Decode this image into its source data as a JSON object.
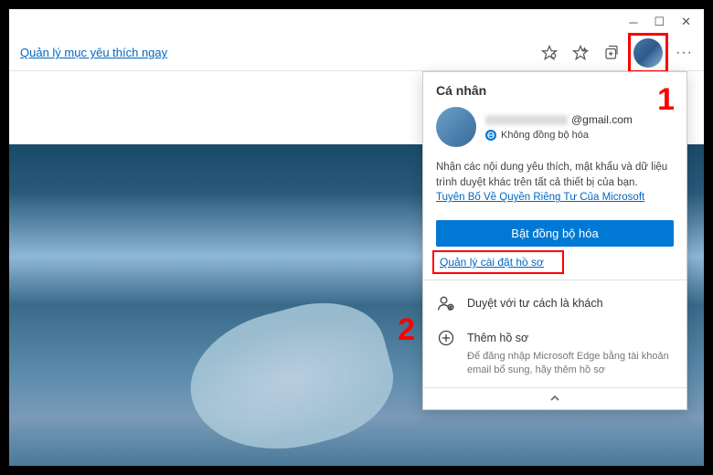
{
  "titlebar": {
    "minimize": "─",
    "maximize": "☐",
    "close": "✕"
  },
  "toolbar": {
    "favorites_link": "Quản lý mục yêu thích ngay"
  },
  "popup": {
    "title": "Cá nhân",
    "email_suffix": "@gmail.com",
    "sync_status": "Không đồng bộ hóa",
    "description": "Nhận các nội dung yêu thích, mật khẩu và dữ liệu trình duyệt khác trên tất cả thiết bị của bạn.",
    "privacy_link": "Tuyên Bố Về Quyền Riêng Tư Của Microsoft",
    "sync_button": "Bật đồng bộ hóa",
    "manage_profile": "Quản lý cài đặt hồ sơ",
    "guest_browse": "Duyệt với tư cách là khách",
    "add_profile": "Thêm hồ sơ",
    "add_profile_desc": "Để đăng nhập Microsoft Edge bằng tài khoản email bổ sung, hãy thêm hồ sơ"
  },
  "annotations": {
    "one": "1",
    "two": "2"
  }
}
